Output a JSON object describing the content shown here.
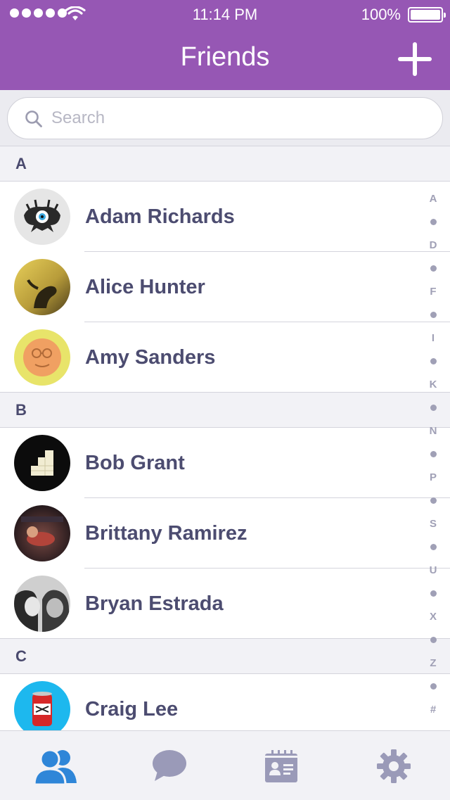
{
  "status_bar": {
    "time": "11:14 PM",
    "battery": "100%"
  },
  "header": {
    "title": "Friends",
    "add_icon": "plus-icon"
  },
  "search": {
    "placeholder": "Search",
    "value": ""
  },
  "sections": [
    {
      "letter": "A",
      "friends": [
        {
          "name": "Adam Richards"
        },
        {
          "name": "Alice Hunter"
        },
        {
          "name": "Amy Sanders"
        }
      ]
    },
    {
      "letter": "B",
      "friends": [
        {
          "name": "Bob Grant"
        },
        {
          "name": "Brittany Ramirez"
        },
        {
          "name": "Bryan Estrada"
        }
      ]
    },
    {
      "letter": "C",
      "friends": [
        {
          "name": "Craig Lee"
        }
      ]
    }
  ],
  "index": [
    "A",
    "D",
    "F",
    "I",
    "K",
    "N",
    "P",
    "S",
    "U",
    "X",
    "Z",
    "#"
  ],
  "tabs": [
    {
      "icon": "friends-icon",
      "active": true
    },
    {
      "icon": "chat-icon",
      "active": false
    },
    {
      "icon": "contacts-card-icon",
      "active": false
    },
    {
      "icon": "gear-icon",
      "active": false
    }
  ],
  "colors": {
    "header": "#9657b4",
    "active_tab": "#2f86d8",
    "inactive_tab": "#9a9ab8",
    "name_text": "#4c4c70"
  }
}
